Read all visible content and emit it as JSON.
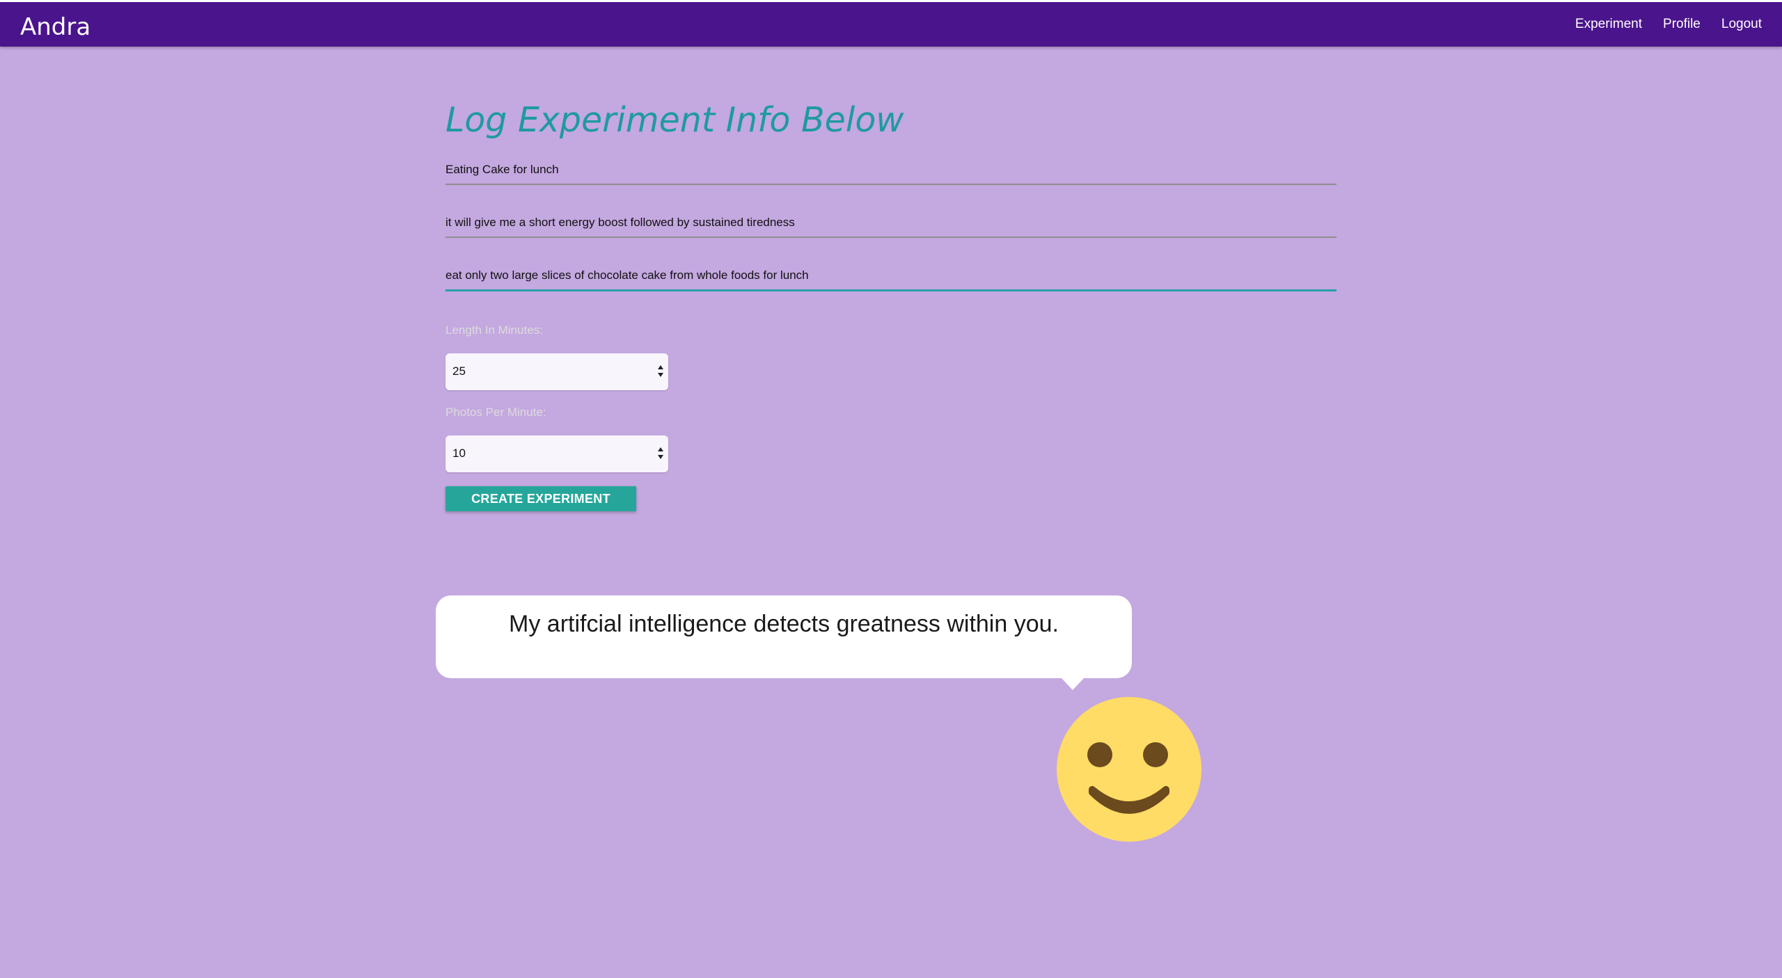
{
  "navbar": {
    "brand": "Andra",
    "links": [
      "Experiment",
      "Profile",
      "Logout"
    ]
  },
  "form": {
    "title": "Log Experiment Info Below",
    "fields": [
      "Eating Cake for lunch",
      "it will give me a short energy boost followed by sustained tiredness",
      "eat only two large slices of chocolate cake from whole foods for lunch"
    ],
    "length_label": "Length In Minutes:",
    "length_value": "25",
    "photos_label": "Photos Per Minute:",
    "photos_value": "10",
    "submit_label": "CREATE EXPERIMENT"
  },
  "assistant": {
    "message": "My artifcial intelligence detects greatness within you.",
    "avatar_icon": "smiley-face-icon"
  },
  "colors": {
    "background": "#c4a8e0",
    "navbar": "#4a148c",
    "accent_teal": "#26a69a",
    "title": "#1e9aa0",
    "smiley_face": "#ffdc66",
    "smiley_features": "#6b4a1e"
  }
}
